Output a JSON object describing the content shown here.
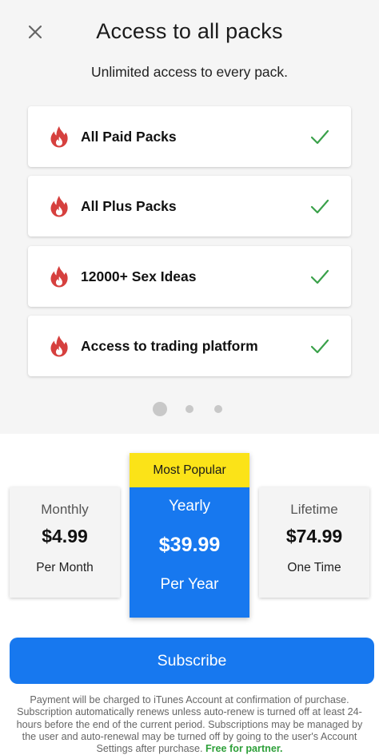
{
  "header": {
    "title": "Access to all packs",
    "subtitle": "Unlimited access to every pack."
  },
  "features": [
    {
      "label": "All Paid Packs",
      "icon": "flame-icon",
      "status_icon": "check-icon"
    },
    {
      "label": "All Plus Packs",
      "icon": "flame-icon",
      "status_icon": "check-icon"
    },
    {
      "label": "12000+ Sex Ideas",
      "icon": "flame-icon",
      "status_icon": "check-icon"
    },
    {
      "label": "Access to trading platform",
      "icon": "flame-icon",
      "status_icon": "check-icon"
    }
  ],
  "carousel": {
    "page_count": 3,
    "active_index": 0
  },
  "plans": {
    "monthly": {
      "name": "Monthly",
      "price": "$4.99",
      "period": "Per Month"
    },
    "yearly": {
      "badge": "Most Popular",
      "name": "Yearly",
      "price": "$39.99",
      "period": "Per Year",
      "selected": true
    },
    "lifetime": {
      "name": "Lifetime",
      "price": "$74.99",
      "period": "One Time"
    }
  },
  "subscribe_label": "Subscribe",
  "legal": {
    "text": "Payment will be charged to iTunes Account at confirmation of purchase. Subscription automatically renews unless auto-renew is turned off at least 24-hours before the end of the current period. Subscriptions may be managed by the user and auto-renewal may be turned off by going to the user's Account Settings after purchase.",
    "partner_link": "Free for partner."
  },
  "colors": {
    "accent_blue": "#1778ef",
    "badge_yellow": "#fbe318",
    "flame_red": "#d6403e",
    "check_green": "#3aa14a",
    "partner_green": "#2ea03a"
  }
}
